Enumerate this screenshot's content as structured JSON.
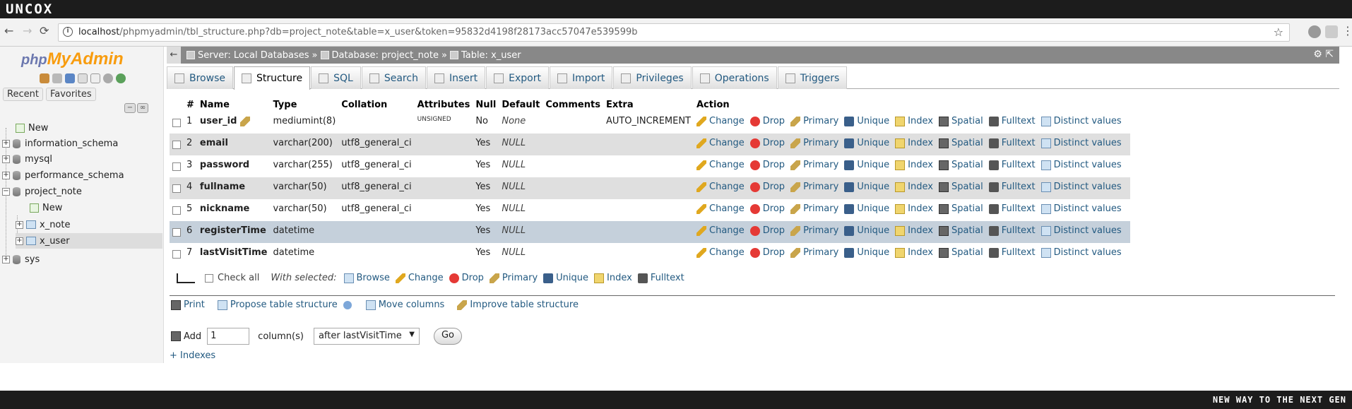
{
  "brand": "UNCOX",
  "footer_slogan": "NEW WAY TO THE NEXT GEN",
  "browser": {
    "url_host": "localhost",
    "url_path": "/phpmyadmin/tbl_structure.php?db=project_note&table=x_user&token=95832d4198f28173acc57047e539599b"
  },
  "logo": {
    "php": "php",
    "my": "My",
    "admin": "Admin"
  },
  "leftnav": {
    "tabs": [
      "Recent",
      "Favorites"
    ],
    "tree": [
      {
        "label": "New"
      },
      {
        "label": "information_schema"
      },
      {
        "label": "mysql"
      },
      {
        "label": "performance_schema"
      },
      {
        "label": "project_note"
      },
      {
        "label": "New"
      },
      {
        "label": "x_note"
      },
      {
        "label": "x_user"
      },
      {
        "label": "sys"
      }
    ]
  },
  "breadcrumb": {
    "server": "Server: Local Databases",
    "database": "Database: project_note",
    "table": "Table: x_user"
  },
  "tabs": [
    "Browse",
    "Structure",
    "SQL",
    "Search",
    "Insert",
    "Export",
    "Import",
    "Privileges",
    "Operations",
    "Triggers"
  ],
  "columns_header": [
    "#",
    "Name",
    "Type",
    "Collation",
    "Attributes",
    "Null",
    "Default",
    "Comments",
    "Extra",
    "Action"
  ],
  "rows": [
    {
      "n": "1",
      "name": "user_id",
      "type": "mediumint(8)",
      "collation": "",
      "attributes": "UNSIGNED",
      "null": "No",
      "default": "None",
      "comments": "",
      "extra": "AUTO_INCREMENT"
    },
    {
      "n": "2",
      "name": "email",
      "type": "varchar(200)",
      "collation": "utf8_general_ci",
      "attributes": "",
      "null": "Yes",
      "default": "NULL",
      "comments": "",
      "extra": ""
    },
    {
      "n": "3",
      "name": "password",
      "type": "varchar(255)",
      "collation": "utf8_general_ci",
      "attributes": "",
      "null": "Yes",
      "default": "NULL",
      "comments": "",
      "extra": ""
    },
    {
      "n": "4",
      "name": "fullname",
      "type": "varchar(50)",
      "collation": "utf8_general_ci",
      "attributes": "",
      "null": "Yes",
      "default": "NULL",
      "comments": "",
      "extra": ""
    },
    {
      "n": "5",
      "name": "nickname",
      "type": "varchar(50)",
      "collation": "utf8_general_ci",
      "attributes": "",
      "null": "Yes",
      "default": "NULL",
      "comments": "",
      "extra": ""
    },
    {
      "n": "6",
      "name": "registerTime",
      "type": "datetime",
      "collation": "",
      "attributes": "",
      "null": "Yes",
      "default": "NULL",
      "comments": "",
      "extra": ""
    },
    {
      "n": "7",
      "name": "lastVisitTime",
      "type": "datetime",
      "collation": "",
      "attributes": "",
      "null": "Yes",
      "default": "NULL",
      "comments": "",
      "extra": ""
    }
  ],
  "row_actions": [
    "Change",
    "Drop",
    "Primary",
    "Unique",
    "Index",
    "Spatial",
    "Fulltext",
    "Distinct values"
  ],
  "bulk": {
    "check_all": "Check all",
    "with_selected": "With selected:",
    "actions": [
      "Browse",
      "Change",
      "Drop",
      "Primary",
      "Unique",
      "Index",
      "Fulltext"
    ]
  },
  "tools": [
    "Print",
    "Propose table structure",
    "Move columns",
    "Improve table structure"
  ],
  "add": {
    "label": "Add",
    "count": "1",
    "unit": "column(s)",
    "position": "after lastVisitTime",
    "go": "Go"
  },
  "indexes_link": "+ Indexes"
}
